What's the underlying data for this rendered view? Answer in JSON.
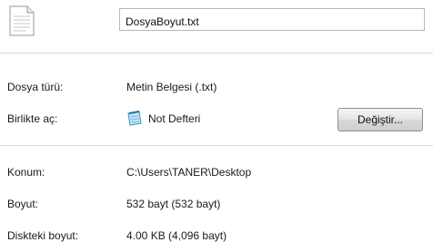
{
  "file": {
    "icon": "text-document-icon",
    "name": "DosyaBoyut.txt"
  },
  "general": {
    "type_label": "Dosya türü:",
    "type_value": "Metin Belgesi (.txt)",
    "opens_with_label": "Birlikte aç:",
    "opens_with_icon": "notepad-icon",
    "opens_with_value": "Not Defteri",
    "change_button": "Değiştir..."
  },
  "details": {
    "location_label": "Konum:",
    "location_value": "C:\\Users\\TANER\\Desktop",
    "size_label": "Boyut:",
    "size_value": "532 bayt (532 bayt)",
    "size_on_disk_label": "Diskteki boyut:",
    "size_on_disk_value": "4.00 KB (4,096 bayt)"
  },
  "colors": {
    "separator": "#d9d9d9",
    "input_border": "#b7b7b7"
  }
}
